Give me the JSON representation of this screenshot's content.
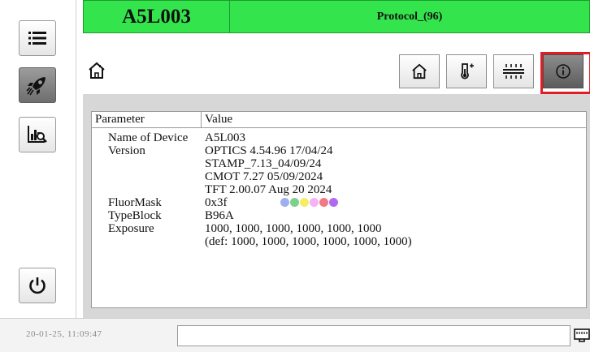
{
  "header": {
    "device": "A5L003",
    "protocol": "Protocol_(96)"
  },
  "sidebar": {
    "items": [
      {
        "name": "menu",
        "icon": "menu-icon"
      },
      {
        "name": "run",
        "icon": "rocket-icon",
        "active": true
      },
      {
        "name": "analysis",
        "icon": "chart-search-icon"
      },
      {
        "name": "power",
        "icon": "power-icon"
      }
    ]
  },
  "toolbar": {
    "buttons": [
      {
        "name": "home",
        "icon": "home-icon"
      },
      {
        "name": "temperature",
        "icon": "thermometer-plus-icon"
      },
      {
        "name": "light",
        "icon": "light-icon"
      },
      {
        "name": "info",
        "icon": "info-icon",
        "active": true
      }
    ]
  },
  "table": {
    "headers": [
      "Parameter",
      "Value"
    ],
    "rows": [
      {
        "param": "Name of Device",
        "value": "A5L003"
      },
      {
        "param": "Version",
        "value": "OPTICS 4.54.96 17/04/24"
      },
      {
        "param": "",
        "value": "STAMP_7.13_04/09/24"
      },
      {
        "param": "",
        "value": "CMOT 7.27 05/09/2024"
      },
      {
        "param": "",
        "value": "TFT 2.00.07 Aug 20 2024"
      },
      {
        "param": "FluorMask",
        "value": "0x3f"
      },
      {
        "param": "TypeBlock",
        "value": "B96A"
      },
      {
        "param": "Exposure",
        "value": "1000, 1000, 1000, 1000, 1000, 1000"
      },
      {
        "param": "",
        "value": "(def: 1000, 1000, 1000, 1000, 1000, 1000)"
      }
    ],
    "fluor_colors": [
      "#9fb0f0",
      "#7fd08a",
      "#f4ee66",
      "#f6b2f2",
      "#f07a86",
      "#b06af0"
    ]
  },
  "footer": {
    "timestamp": "20-01-25, 11:09:47",
    "message": ""
  },
  "colors": {
    "header_green": "#34e44c",
    "highlight_red": "#e21b24"
  }
}
